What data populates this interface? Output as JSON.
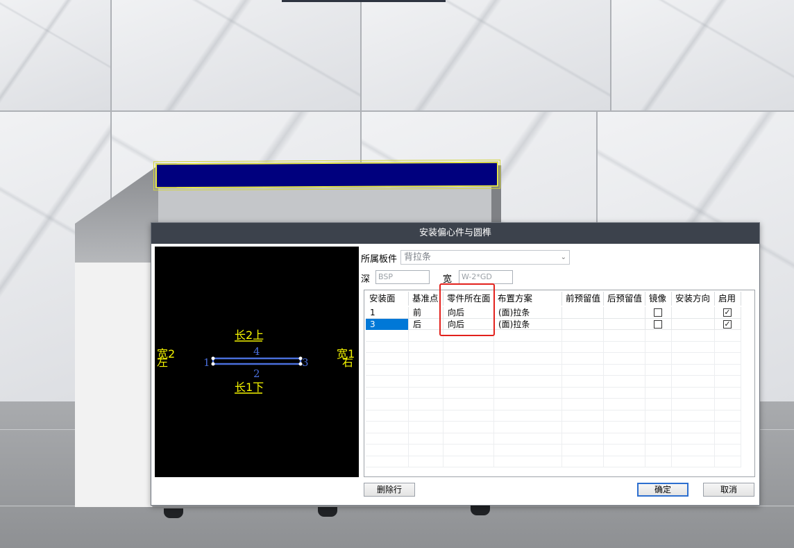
{
  "dialog": {
    "title": "安装偏心件与圆榫",
    "plate_label": "所属板件",
    "plate_value": "背拉条",
    "depth_label": "深",
    "depth_value": "BSP",
    "width_label": "宽",
    "width_value": "W-2*GD"
  },
  "preview": {
    "top_label": "长2上",
    "bottom_label": "长1下",
    "left_label_1": "宽2",
    "left_label_2": "左",
    "right_label_1": "宽1",
    "right_label_2": "右",
    "edge_top": "4",
    "edge_bottom": "2",
    "edge_left": "1",
    "edge_right": "3",
    "label_color": "#f5f500",
    "edge_color": "#4a6fdc"
  },
  "table": {
    "columns": [
      "安装面",
      "基准点",
      "零件所在面",
      "布置方案",
      "前预留值",
      "后预留值",
      "镜像",
      "安装方向",
      "启用"
    ],
    "rows": [
      {
        "face": "1",
        "base": "前",
        "part_face": "向后",
        "scheme": "(面)拉条",
        "front_reserve": "",
        "back_reserve": "",
        "mirror": false,
        "direction": "",
        "enabled": true,
        "selected": false
      },
      {
        "face": "3",
        "base": "后",
        "part_face": "向后",
        "scheme": "(面)拉条",
        "front_reserve": "",
        "back_reserve": "",
        "mirror": false,
        "direction": "",
        "enabled": true,
        "selected": true
      }
    ],
    "highlight_color": "#e2211c"
  },
  "buttons": {
    "delete_row": "删除行",
    "ok": "确定",
    "cancel": "取消"
  },
  "colors": {
    "titlebar": "#3c424c",
    "selection": "#0078d7",
    "rail": "#00007e"
  }
}
